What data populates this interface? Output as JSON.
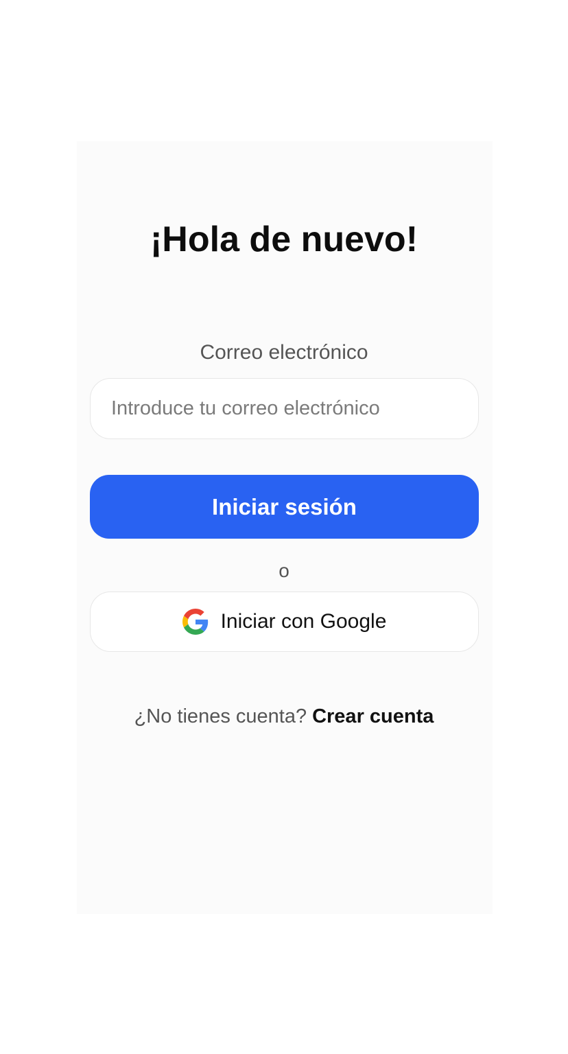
{
  "header": {
    "title": "¡Hola de nuevo!"
  },
  "form": {
    "email_label": "Correo electrónico",
    "email_placeholder": "Introduce tu correo electrónico",
    "email_value": "",
    "submit_label": "Iniciar sesión",
    "divider_text": "o",
    "google_label": "Iniciar con Google"
  },
  "footer": {
    "prompt": "¿No tienes cuenta?",
    "signup_link": "Crear cuenta"
  },
  "icons": {
    "google": "google-icon"
  },
  "colors": {
    "primary": "#2962f2",
    "panel_background": "#fbfbfb",
    "google_blue": "#4285F4",
    "google_red": "#EA4335",
    "google_yellow": "#FBBC05",
    "google_green": "#34A853"
  }
}
